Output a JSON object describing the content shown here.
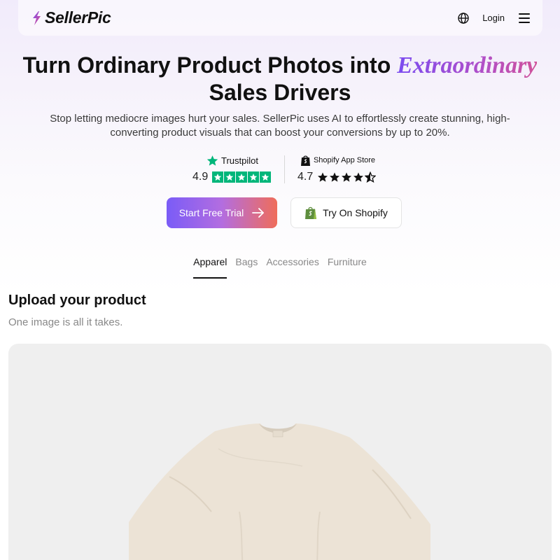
{
  "header": {
    "brand": "SellerPic",
    "login_label": "Login",
    "icons": {
      "logo": "bolt-icon",
      "language": "globe-icon",
      "menu": "hamburger-menu-icon"
    }
  },
  "hero": {
    "title_before": "Turn Ordinary Product Photos into ",
    "title_accent": "Extraordinary",
    "title_after": "Sales Drivers",
    "subtitle": "Stop letting mediocre images hurt your sales. SellerPic uses AI to effortlessly create stunning, high-converting product visuals that can boost your conversions by up to 20%."
  },
  "ratings": {
    "trustpilot": {
      "brand": "Trustpilot",
      "score": "4.9",
      "stars": 5
    },
    "shopify": {
      "brand": "Shopify App Store",
      "score": "4.7",
      "stars": 4.5
    }
  },
  "cta": {
    "trial_label": "Start Free Trial",
    "shopify_label": "Try On Shopify"
  },
  "tabs": [
    {
      "label": "Apparel",
      "active": true
    },
    {
      "label": "Bags",
      "active": false
    },
    {
      "label": "Accessories",
      "active": false
    },
    {
      "label": "Furniture",
      "active": false
    }
  ],
  "upload": {
    "title": "Upload your product",
    "subtitle": "One image is all it takes."
  },
  "colors": {
    "accent_purple": "#7a5cf7",
    "accent_coral": "#ef6d5a",
    "trustpilot_green": "#00b67a",
    "preview_bg": "#efefef",
    "garment": "#ece3d6"
  }
}
